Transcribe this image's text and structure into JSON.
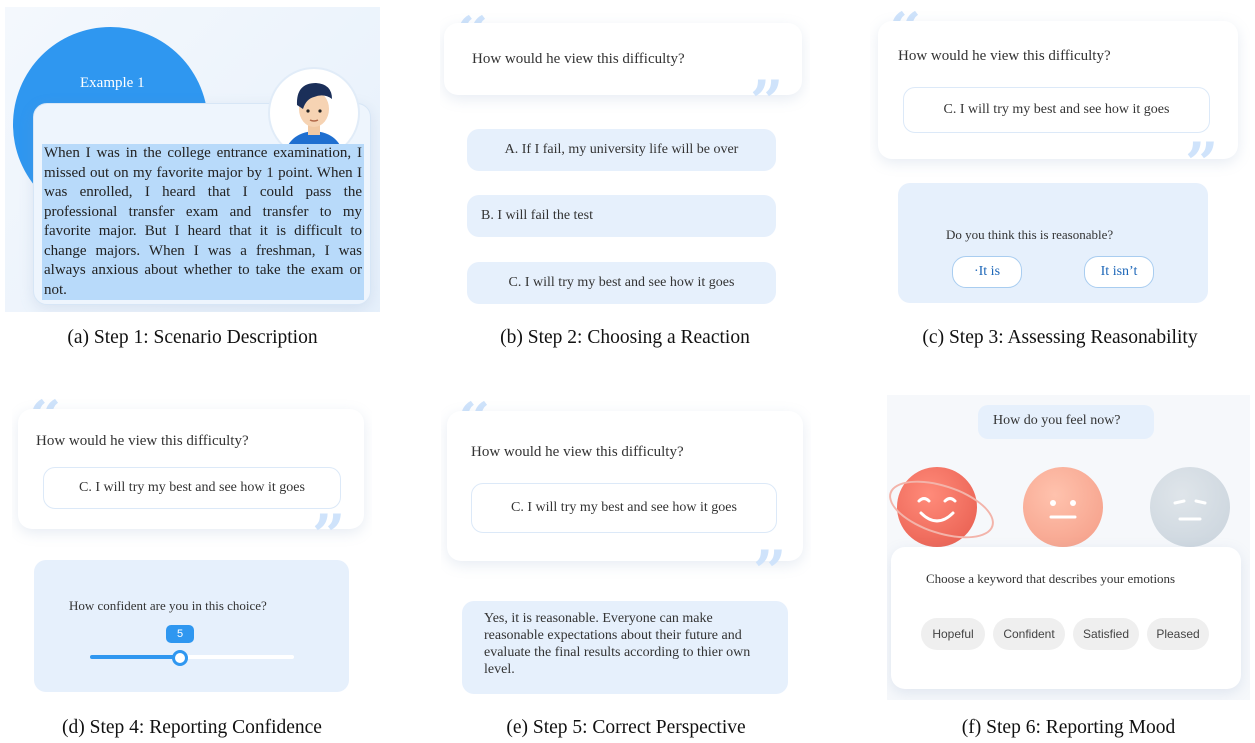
{
  "colors": {
    "accent": "#2f97f0",
    "light_blue": "#e6f0fc",
    "highlight": "#b8dafa",
    "quote": "#cfe3fb"
  },
  "panel_a": {
    "example_label": "Example 1",
    "scenario_text": "When I was in the college entrance examination, I missed out on my favorite major by 1 point. When I was enrolled, I heard that I could pass the professional transfer exam and transfer to my favorite major. But I heard that it is difficult to change majors. When I was a freshman, I was always anxious about whether to take the exam or not.",
    "caption": "(a) Step 1: Scenario Description"
  },
  "panel_b": {
    "question": "How would he view this difficulty?",
    "options": [
      "A. If I fail, my university life will be over",
      "B. I will fail the test",
      "C. I will try my best and see how it goes"
    ],
    "caption": "(b) Step 2: Choosing a Reaction"
  },
  "panel_c": {
    "question": "How would he view this difficulty?",
    "selected": "C. I will try my best and see how it goes",
    "prompt": "Do you think this is reasonable?",
    "yes": "·It is",
    "no": "It isn’t",
    "caption": "(c) Step 3: Assessing Reasonability"
  },
  "panel_d": {
    "question": "How would he view this difficulty?",
    "selected": "C. I will try my best and see how it goes",
    "prompt": "How confident are you in this choice?",
    "slider_value": "5",
    "slider_fraction": 0.44,
    "caption": "(d) Step 4: Reporting Confidence"
  },
  "panel_e": {
    "question": "How would he view this difficulty?",
    "selected": "C. I will try my best and see how it goes",
    "perspective": "Yes, it is reasonable. Everyone can make reasonable expectations about their future and evaluate the final results according to thier own level.",
    "caption": "(e) Step 5: Correct Perspective"
  },
  "panel_f": {
    "question": "How do you feel now?",
    "faces": [
      "happy-face-icon",
      "neutral-face-icon",
      "sad-face-icon"
    ],
    "keyword_prompt": "Choose a keyword that describes your emotions",
    "keywords": [
      "Hopeful",
      "Confident",
      "Satisfied",
      "Pleased"
    ],
    "caption": "(f) Step 6: Reporting Mood"
  }
}
